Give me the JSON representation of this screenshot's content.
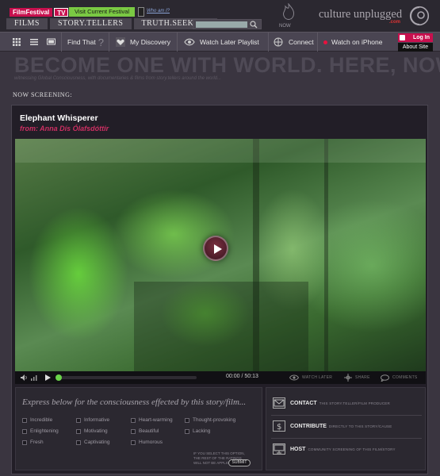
{
  "header": {
    "filmfestival_label": "FilmFestival",
    "tv_label": "TV",
    "visit_label": "Visit Current Festival",
    "who_label": "Who am I?",
    "tabs": [
      "FILMS",
      "STORY.TELLERS",
      "TRUTH.SEEKERS"
    ],
    "search_placeholder": "",
    "now_label": "NOW",
    "brand": "culture unplugged",
    "brand_suffix": ".com"
  },
  "navbar": {
    "find_label": "Find That",
    "find_q": "?",
    "discovery_label": "My Discovery",
    "watch_later_label": "Watch Later Playlist",
    "connect_label": "Connect",
    "iphone_label": "Watch on iPhone",
    "login_label": "Log In",
    "about_label": "About Site"
  },
  "banner": {
    "headline": "BECOME ONE WITH WORLD. HERE, NOW.",
    "tagline": "witnessing Global Consciousness, with documentaries & films from story.tellers around the world..."
  },
  "now_screening": "NOW SCREENING:",
  "film": {
    "title": "Elephant Whisperer",
    "from": "from: Anna Dís Ólafsdóttir"
  },
  "player": {
    "progress": 0.0,
    "time": "00:00 / 50:13",
    "watch_later": "WATCH LATER",
    "share": "SHARE",
    "comments": "COMMENTS"
  },
  "feelings": {
    "title": "Express below for the consciousness effected by this story/film...",
    "options": [
      [
        "Incredible",
        "Informative",
        "Heart-warming",
        "Thought-provoking"
      ],
      [
        "Enlightening",
        "Motivating",
        "Beautiful",
        "Lacking"
      ],
      [
        "Fresh",
        "Captivating",
        "Humorous",
        ""
      ]
    ],
    "note": "IF YOU SELECT THIS OPTION, THE REST OF THE RATINGS WILL NOT BE APPLICABLE",
    "submit_label": "SUBMIT"
  },
  "actions": [
    {
      "label": "CONTACT",
      "sub": "THIS STORY.TELLER/FILM PRODUCER"
    },
    {
      "label": "CONTRIBUTE",
      "sub": "DIRECTLY TO THIS STORY/CAUSE"
    },
    {
      "label": "HOST",
      "sub": "COMMUNITY SCREENING OF THIS FILM/STORY"
    }
  ],
  "colors": {
    "accent": "#c8104e",
    "green_button": "#7ac943",
    "from_text": "#cc2f62",
    "background": "#3a3540"
  }
}
